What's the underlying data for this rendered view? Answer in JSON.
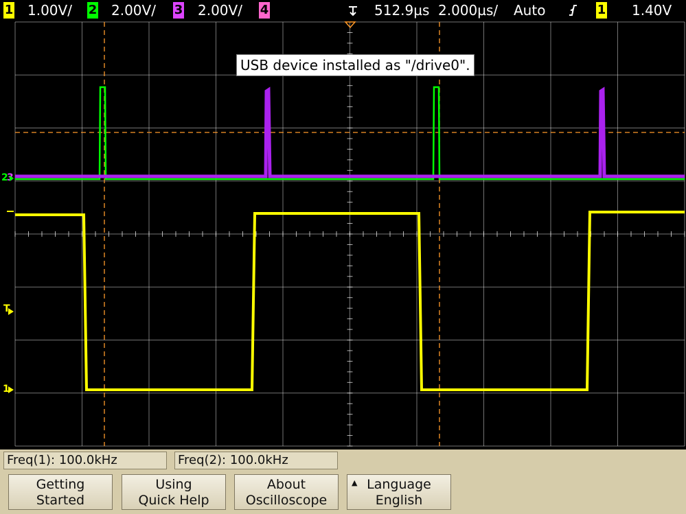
{
  "status_bar": {
    "ch1": {
      "num": "1",
      "scale": "1.00V/",
      "color": "#ffff00"
    },
    "ch2": {
      "num": "2",
      "scale": "2.00V/",
      "color": "#00ff00"
    },
    "ch3": {
      "num": "3",
      "scale": "2.00V/",
      "color": "#dd44ff"
    },
    "ch4": {
      "num": "4",
      "scale": "",
      "color": "#ff66cc"
    },
    "delay": "512.9µs",
    "timebase": "2.000µs/",
    "trigger_mode": "Auto",
    "trigger_source": "1",
    "trigger_level": "1.40V",
    "icons": [
      "trigger-position-icon",
      "rising-edge-icon"
    ]
  },
  "display": {
    "message": "USB device installed as \"/drive0\".",
    "markers": {
      "ch1": "1",
      "ch2": "2",
      "ch3": "3",
      "trigger": "T"
    },
    "colors": {
      "grid": "#ffffff",
      "cursor": "#ff9a2a"
    }
  },
  "measurements": [
    {
      "label": "Freq(1): 100.0kHz"
    },
    {
      "label": "Freq(2): 100.0kHz"
    }
  ],
  "softkeys": [
    {
      "line1": "Getting",
      "line2": "Started"
    },
    {
      "line1": "Using",
      "line2": "Quick Help"
    },
    {
      "line1": "About",
      "line2": "Oscilloscope"
    },
    {
      "line1": "Language",
      "line2": "English",
      "icon": "up-triangle-icon"
    }
  ]
}
